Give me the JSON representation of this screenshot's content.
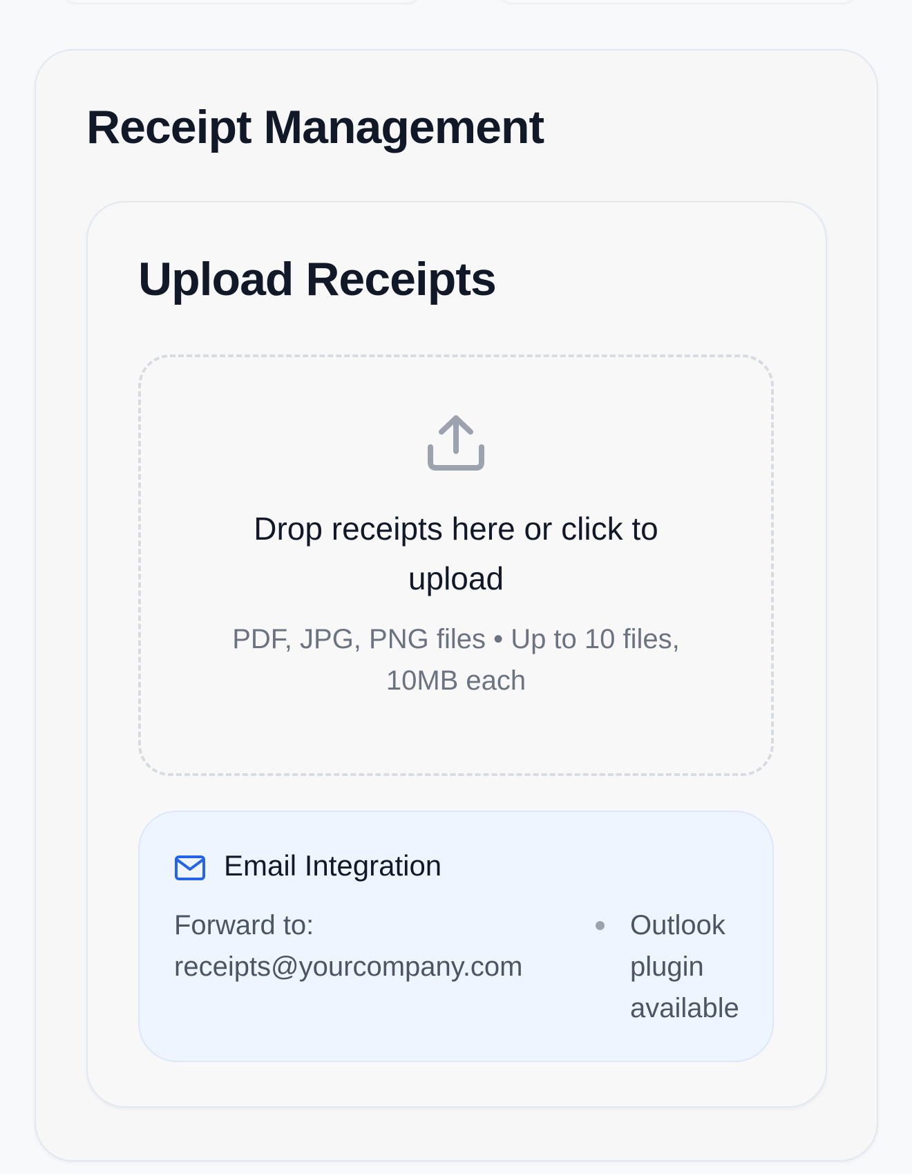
{
  "page": {
    "title": "Receipt Management"
  },
  "upload": {
    "title": "Upload Receipts",
    "icon": "upload-icon",
    "drop_text": "Drop receipts here or click to upload",
    "subtext": "PDF, JPG, PNG files • Up to 10 files, 10MB each"
  },
  "email_integration": {
    "icon": "mail-icon",
    "title": "Email Integration",
    "forward_text": "Forward to: receipts@yourcompany.com",
    "plugin_text": "Outlook plugin available"
  },
  "colors": {
    "page_bg": "#f8f9fb",
    "card_bg": "#f7f7f8",
    "card_border": "#e2e8f0",
    "email_bg": "#eff5fe",
    "email_border": "#dbe7fb",
    "accent_blue": "#2563eb",
    "icon_gray": "#9ca3af",
    "text_primary": "#111827",
    "text_muted": "#6b7280"
  }
}
